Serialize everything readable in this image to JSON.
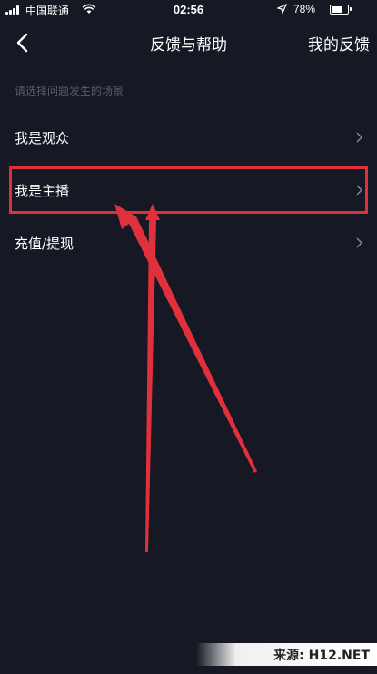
{
  "status_bar": {
    "carrier": "中国联通",
    "time": "02:56",
    "battery_percent": "78%",
    "battery_level": 0.78,
    "icons": [
      "signal-icon",
      "wifi-icon",
      "location-arrow-icon",
      "battery-icon"
    ]
  },
  "nav": {
    "back_icon": "chevron-left-icon",
    "title": "反馈与帮助",
    "right_action": "我的反馈"
  },
  "section": {
    "caption": "请选择问题发生的场景"
  },
  "options": [
    {
      "label": "我是观众",
      "icon": "chevron-right-icon"
    },
    {
      "label": "我是主播",
      "icon": "chevron-right-icon"
    },
    {
      "label": "充值/提现",
      "icon": "chevron-right-icon"
    }
  ],
  "colors": {
    "background": "#161823",
    "text": "#ffffff",
    "caption": "#5a5c66",
    "annotation": "#e0303b"
  },
  "watermark": {
    "text": "来源: H12.NET"
  }
}
